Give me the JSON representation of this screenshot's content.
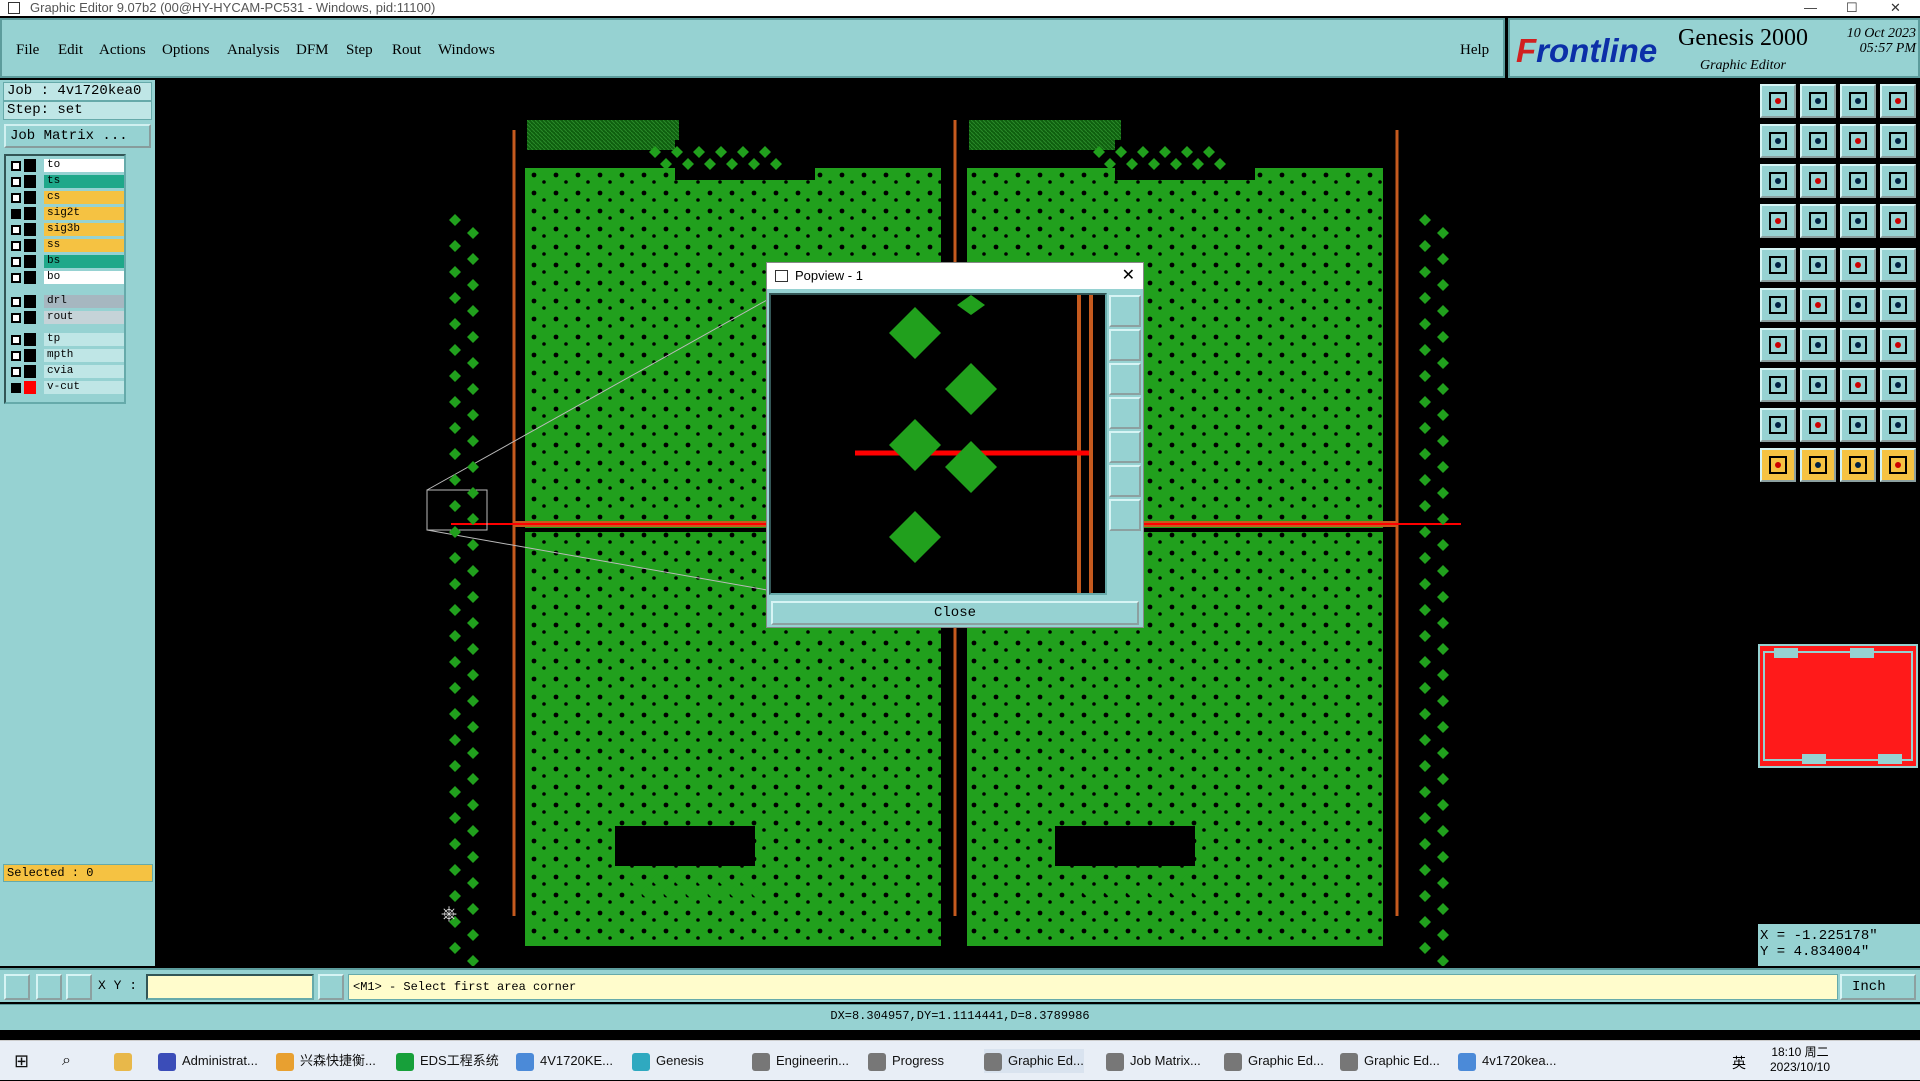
{
  "window": {
    "title": "Graphic Editor 9.07b2 (00@HY-HYCAM-PC531 - Windows, pid:11100)"
  },
  "menu": {
    "items": [
      "File",
      "Edit",
      "Actions",
      "Options",
      "Analysis",
      "DFM",
      "Step",
      "Rout",
      "Windows"
    ],
    "help": "Help"
  },
  "brand": {
    "logo_prefix": "F",
    "logo": "rontline",
    "product": "Genesis 2000",
    "subtitle": "Graphic Editor",
    "date": "10 Oct 2023",
    "time": "05:57 PM"
  },
  "job": {
    "job_line": "Job : 4v1720kea0",
    "step_line": "Step: set",
    "matrix_button": "Job Matrix ..."
  },
  "layers": [
    {
      "name": "to",
      "color": "#ffffff",
      "checked": false,
      "swatch": "#000000"
    },
    {
      "name": "ts",
      "color": "#1fa88a",
      "checked": false,
      "swatch": "#000000"
    },
    {
      "name": "cs",
      "color": "#f5c242",
      "checked": false,
      "swatch": "#000000"
    },
    {
      "name": "sig2t",
      "color": "#f5c242",
      "checked": true,
      "swatch": "#000000"
    },
    {
      "name": "sig3b",
      "color": "#f5c242",
      "checked": false,
      "swatch": "#000000"
    },
    {
      "name": "ss",
      "color": "#f5c242",
      "checked": false,
      "swatch": "#000000"
    },
    {
      "name": "bs",
      "color": "#1fa88a",
      "checked": false,
      "swatch": "#000000"
    },
    {
      "name": "bo",
      "color": "#ffffff",
      "checked": false,
      "swatch": "#000000"
    },
    {
      "name": "drl",
      "color": "#a6b7c0",
      "checked": false,
      "swatch": "#000000"
    },
    {
      "name": "rout",
      "color": "#c5d3d8",
      "checked": false,
      "swatch": "#000000"
    },
    {
      "name": "tp",
      "color": "#bfe6e6",
      "checked": false,
      "swatch": "#000000"
    },
    {
      "name": "mpth",
      "color": "#bfe6e6",
      "checked": false,
      "swatch": "#000000"
    },
    {
      "name": "cvia",
      "color": "#bfe6e6",
      "checked": false,
      "swatch": "#000000"
    },
    {
      "name": "v-cut",
      "color": "#bfe6e6",
      "checked": true,
      "swatch": "#ff0000"
    }
  ],
  "selected": "Selected : 0",
  "coords": {
    "x": "X = -1.225178\"",
    "y": "Y = 4.834004\""
  },
  "status": {
    "xy_label": "X Y :",
    "xy_value": "",
    "prompt": "<M1> - Select first area corner",
    "units": "Inch",
    "measure": "DX=8.304957,DY=1.1114441,D=8.3789986"
  },
  "popview": {
    "title": "Popview - 1",
    "close_label": "Close"
  },
  "taskbar": {
    "items": [
      "Administrat...",
      "兴森快捷衡...",
      "EDS工程系统",
      "4V1720KE...",
      "Genesis",
      "Engineerin...",
      "Progress",
      "Graphic Ed...",
      "Job Matrix...",
      "Graphic Ed...",
      "Graphic Ed...",
      "4v1720kea..."
    ],
    "time": "18:10 周二",
    "date": "2023/10/10",
    "ime": "英"
  },
  "colors": {
    "board": "#21a01d",
    "board_dark": "#0c5a0c",
    "panel": "#96d2d2",
    "rout": "#c55a1e",
    "vcut": "#ff0000"
  }
}
